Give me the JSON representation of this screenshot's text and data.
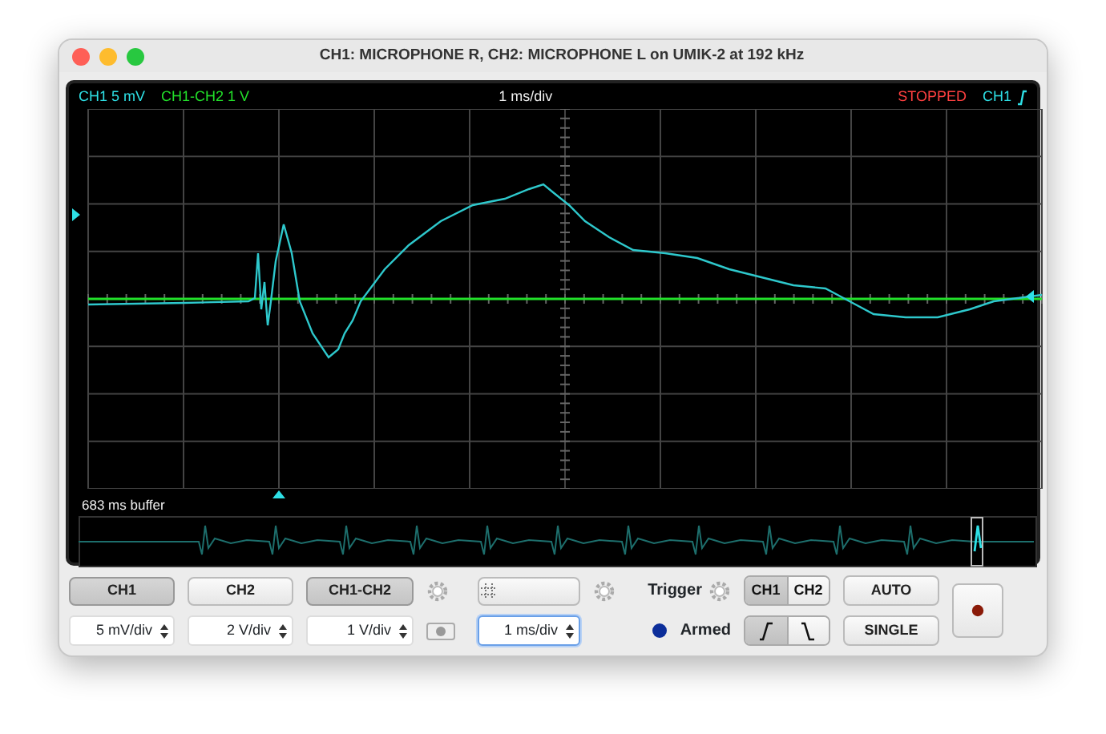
{
  "window": {
    "title": "CH1: MICROPHONE R, CH2: MICROPHONE L on UMIK-2 at 192 kHz"
  },
  "scope": {
    "ch1_label": "CH1 5 mV",
    "math_label": "CH1-CH2 1 V",
    "timebase": "1 ms/div",
    "status": "STOPPED",
    "trigger_channel": "CH1",
    "buffer_label": "683 ms buffer"
  },
  "channels": [
    {
      "label": "CH1",
      "selected": true,
      "value": "5 mV/div"
    },
    {
      "label": "CH2",
      "selected": false,
      "value": "2 V/div"
    },
    {
      "label": "CH1-CH2",
      "selected": true,
      "value": "1 V/div"
    }
  ],
  "timebase": {
    "value": "1 ms/div"
  },
  "trigger": {
    "label": "Trigger",
    "status": "Armed",
    "armed": true,
    "sources": [
      {
        "label": "CH1",
        "selected": true
      },
      {
        "label": "CH2",
        "selected": false
      }
    ],
    "slopes": [
      {
        "kind": "rising",
        "selected": true
      },
      {
        "kind": "falling",
        "selected": false
      }
    ]
  },
  "modes": [
    "AUTO",
    "SINGLE"
  ]
}
